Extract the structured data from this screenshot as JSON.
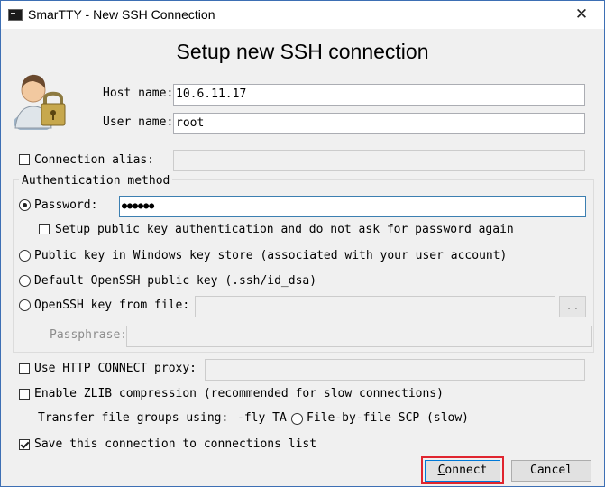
{
  "window": {
    "title": "SmarTTY - New SSH Connection",
    "close_glyph": "✕"
  },
  "heading": "Setup new SSH connection",
  "icon": "user-lock-icon",
  "host": {
    "label": "Host name:",
    "value": "10.6.11.17"
  },
  "user": {
    "label": "User name:",
    "value": "root"
  },
  "alias": {
    "label": "Connection alias:",
    "value": "",
    "checked": false
  },
  "auth": {
    "group_label": "Authentication method",
    "password_label": "Password:",
    "password_value": "●●●●●●",
    "setup_pubkey_label": "Setup public key authentication and do not ask for password again",
    "windows_store_label": "Public key in Windows key store (associated with your user account)",
    "default_openssh_label": "Default OpenSSH public key (.ssh/id_dsa)",
    "openssh_file_label": "OpenSSH key from file:",
    "browse_label": "..",
    "passphrase_label": "Passphrase:"
  },
  "http_proxy": {
    "label": "Use HTTP CONNECT proxy:",
    "checked": false
  },
  "zlib": {
    "label": "Enable ZLIB compression (recommended for slow connections)",
    "checked": false
  },
  "transfer": {
    "label": "Transfer file groups using:",
    "option1": "-fly TA",
    "option2": "File-by-file SCP (slow)"
  },
  "save": {
    "label": "Save this connection to connections list",
    "checked": true
  },
  "buttons": {
    "connect_first": "C",
    "connect_rest": "onnect",
    "cancel": "Cancel"
  },
  "colors": {
    "highlight": "#e0252f",
    "focus": "#0078d7"
  }
}
